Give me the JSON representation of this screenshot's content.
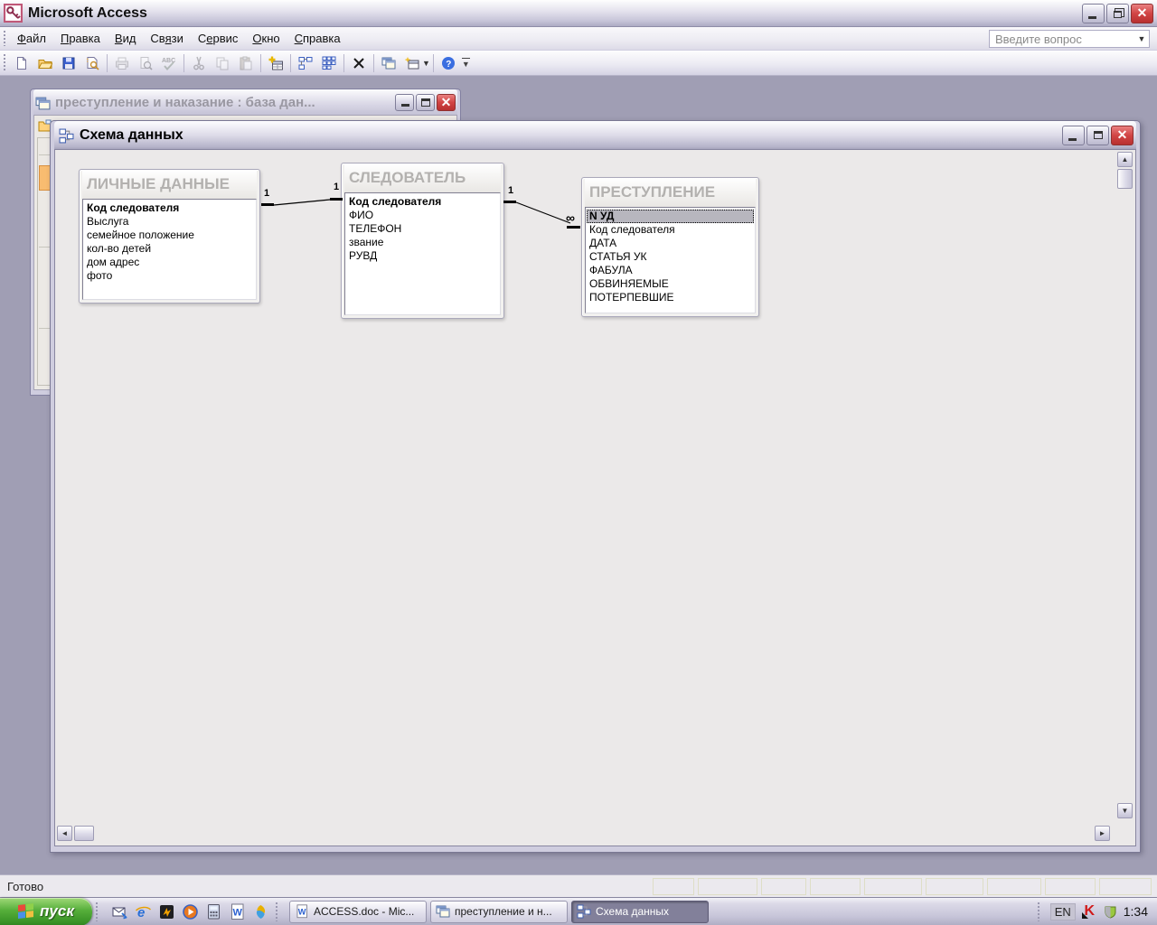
{
  "app": {
    "title": "Microsoft Access",
    "question_box": "Введите вопрос",
    "status_ready": "Готово"
  },
  "menu": {
    "items": [
      {
        "label": "Файл",
        "u": 0
      },
      {
        "label": "Правка",
        "u": 0
      },
      {
        "label": "Вид",
        "u": 0
      },
      {
        "label": "Связи",
        "u": 2
      },
      {
        "label": "Сервис",
        "u": 1
      },
      {
        "label": "Окно",
        "u": 0
      },
      {
        "label": "Справка",
        "u": 0
      }
    ]
  },
  "toolbar": {
    "buttons": [
      {
        "name": "new",
        "disabled": false
      },
      {
        "name": "open",
        "disabled": false
      },
      {
        "name": "save",
        "disabled": false
      },
      {
        "name": "file-search",
        "disabled": false
      },
      {
        "sep": true
      },
      {
        "name": "print",
        "disabled": true
      },
      {
        "name": "print-preview",
        "disabled": true
      },
      {
        "name": "spelling",
        "disabled": true
      },
      {
        "sep": true
      },
      {
        "name": "cut",
        "disabled": true
      },
      {
        "name": "copy",
        "disabled": true
      },
      {
        "name": "paste",
        "disabled": true
      },
      {
        "sep": true
      },
      {
        "name": "show-table",
        "disabled": false
      },
      {
        "sep": true
      },
      {
        "name": "direct-relationships",
        "disabled": false
      },
      {
        "name": "all-relationships",
        "disabled": false
      },
      {
        "sep": true
      },
      {
        "name": "delete",
        "disabled": false
      },
      {
        "sep": true
      },
      {
        "name": "database-window",
        "disabled": false
      },
      {
        "name": "new-object",
        "disabled": false,
        "dropdown": true
      },
      {
        "sep": true
      },
      {
        "name": "help",
        "disabled": false
      }
    ]
  },
  "windows": {
    "database": {
      "title": "преступление и наказание : база дан..."
    },
    "schema": {
      "title": "Схема данных"
    }
  },
  "diagram": {
    "tables": [
      {
        "name": "ЛИЧНЫЕ ДАННЫЕ",
        "fields": [
          {
            "name": "Код следователя",
            "pk": true
          },
          {
            "name": "Выслуга"
          },
          {
            "name": "семейное положение"
          },
          {
            "name": "кол-во детей"
          },
          {
            "name": "дом  адрес"
          },
          {
            "name": "фото"
          }
        ]
      },
      {
        "name": "СЛЕДОВАТЕЛЬ",
        "fields": [
          {
            "name": "Код следователя",
            "pk": true
          },
          {
            "name": "ФИО"
          },
          {
            "name": "ТЕЛЕФОН"
          },
          {
            "name": "звание"
          },
          {
            "name": "РУВД"
          }
        ]
      },
      {
        "name": "ПРЕСТУПЛЕНИЕ",
        "fields": [
          {
            "name": "N УД",
            "pk": true,
            "selected": true
          },
          {
            "name": "Код следователя"
          },
          {
            "name": "ДАТА"
          },
          {
            "name": "СТАТЬЯ УК"
          },
          {
            "name": "ФАБУЛА"
          },
          {
            "name": "ОБВИНЯЕМЫЕ"
          },
          {
            "name": "ПОТЕРПЕВШИЕ"
          }
        ]
      }
    ],
    "relations": [
      {
        "from": "ЛИЧНЫЕ ДАННЫЕ",
        "to": "СЛЕДОВАТЕЛЬ",
        "from_label": "1",
        "to_label": "1"
      },
      {
        "from": "СЛЕДОВАТЕЛЬ",
        "to": "ПРЕСТУПЛЕНИЕ",
        "from_label": "1",
        "to_label": "∞"
      }
    ]
  },
  "taskbar": {
    "start_label": "пуск",
    "quicklaunch": [
      "outlook-express",
      "internet-explorer",
      "winamp",
      "media-player",
      "calculator",
      "word",
      "msn"
    ],
    "tasks": [
      {
        "label": "ACCESS.doc - Mic...",
        "icon": "word",
        "active": false
      },
      {
        "label": "преступление и н...",
        "icon": "access-db",
        "active": false
      },
      {
        "label": "Схема данных",
        "icon": "relationships",
        "active": true
      }
    ],
    "tray": {
      "language": "EN",
      "icons": [
        "kaspersky",
        "shield"
      ],
      "clock": "1:34"
    }
  },
  "colors": {
    "workspace": "#a09eb4",
    "close_button": "#d14444",
    "selection_bg": "#b7b6be",
    "start_button_green": "#3a9427",
    "table_title_text": "#b3b1af"
  }
}
